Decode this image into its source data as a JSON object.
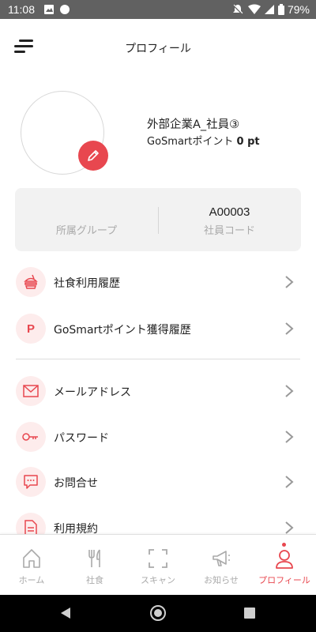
{
  "status_bar": {
    "time": "11:08",
    "battery": "79%"
  },
  "header": {
    "title": "プロフィール"
  },
  "profile": {
    "name": "外部企業A_社員③",
    "points_label": "GoSmartポイント",
    "points_value": "0 pt"
  },
  "info_card": {
    "group": {
      "value": "",
      "label": "所属グループ"
    },
    "code": {
      "value": "A00003",
      "label": "社員コード"
    }
  },
  "menu": {
    "items": [
      {
        "label": "社食利用履歴",
        "icon": "meal-history-icon"
      },
      {
        "label": "GoSmartポイント獲得履歴",
        "icon": "points-icon",
        "icon_text": "P"
      },
      {
        "label": "メールアドレス",
        "icon": "mail-icon"
      },
      {
        "label": "パスワード",
        "icon": "key-icon"
      },
      {
        "label": "お問合せ",
        "icon": "chat-icon"
      },
      {
        "label": "利用規約",
        "icon": "document-icon"
      }
    ]
  },
  "bottom_nav": {
    "items": [
      {
        "label": "ホーム",
        "icon": "home-icon"
      },
      {
        "label": "社食",
        "icon": "cutlery-icon"
      },
      {
        "label": "スキャン",
        "icon": "scan-icon"
      },
      {
        "label": "お知らせ",
        "icon": "megaphone-icon"
      },
      {
        "label": "プロフィール",
        "icon": "person-icon",
        "active": true
      }
    ]
  },
  "colors": {
    "accent": "#e8474f",
    "accent_light": "#fdecec",
    "card_bg": "#f2f2f2",
    "muted": "#aaaaaa"
  }
}
